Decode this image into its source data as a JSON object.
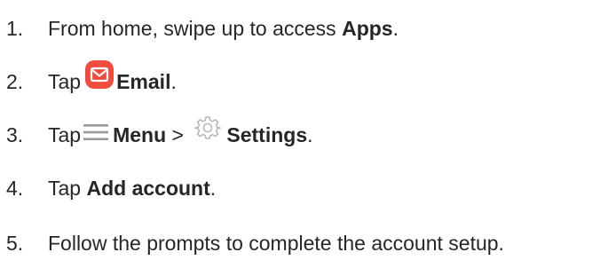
{
  "steps": [
    {
      "number": "1.",
      "text_before": "From home, swipe up to access ",
      "bold": "Apps",
      "text_after": "."
    },
    {
      "number": "2.",
      "text_before": "Tap",
      "icon": "email-icon",
      "bold": "Email",
      "text_after": "."
    },
    {
      "number": "3.",
      "text_before": "Tap",
      "icon1": "menu-icon",
      "bold1": "Menu",
      "separator": " > ",
      "icon2": "gear-icon",
      "bold2": "Settings",
      "text_after": "."
    },
    {
      "number": "4.",
      "text_before": "Tap ",
      "bold": "Add account",
      "text_after": "."
    },
    {
      "number": "5.",
      "text": "Follow the prompts to complete the account setup."
    }
  ],
  "colors": {
    "text": "#262626",
    "email_icon": "#f04b3c",
    "menu_icon": "#9a9a9a",
    "gear_icon": "#b5b5b5"
  }
}
